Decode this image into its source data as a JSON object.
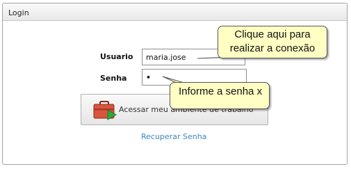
{
  "panel": {
    "title": "Login"
  },
  "form": {
    "user_label": "Usuario",
    "user_value": "maria.jose",
    "password_label": "Senha",
    "password_value": "•"
  },
  "submit": {
    "label": "Acessar meu ambiente de trabalho",
    "icon": "toolbox-arrow-icon"
  },
  "recover_link": "Recuperar Senha",
  "tooltips": {
    "login_hint_line1": "Clique aqui para",
    "login_hint_line2": "realizar a conexão",
    "password_hint": "Informe a senha x"
  },
  "colors": {
    "tooltip_bg": "#ffffc4",
    "link": "#3b86c0"
  }
}
